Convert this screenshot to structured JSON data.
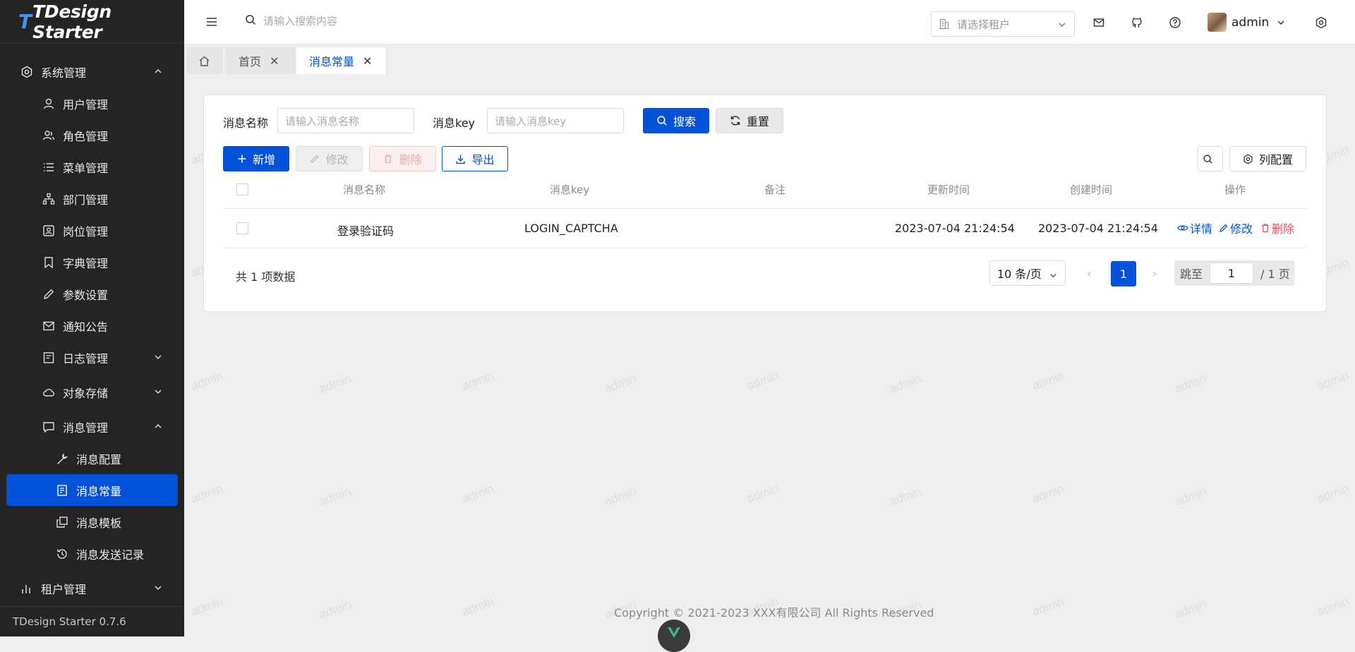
{
  "app": {
    "logo_t": "T",
    "logo_text": "TDesign Starter",
    "version": "TDesign Starter 0.7.6"
  },
  "sidebar": {
    "groups": [
      {
        "label": "系统管理",
        "icon": "system-hexagon-icon",
        "expanded": true
      },
      {
        "label": "用户管理",
        "icon": "user-icon"
      },
      {
        "label": "角色管理",
        "icon": "role-users-icon"
      },
      {
        "label": "菜单管理",
        "icon": "menu-list-icon"
      },
      {
        "label": "部门管理",
        "icon": "org-tree-icon"
      },
      {
        "label": "岗位管理",
        "icon": "id-card-icon"
      },
      {
        "label": "字典管理",
        "icon": "bookmark-icon"
      },
      {
        "label": "参数设置",
        "icon": "pencil-icon"
      },
      {
        "label": "通知公告",
        "icon": "mail-icon"
      },
      {
        "label": "日志管理",
        "icon": "log-icon",
        "expanded": false
      },
      {
        "label": "对象存储",
        "icon": "cloud-icon",
        "expanded": false
      },
      {
        "label": "消息管理",
        "icon": "chat-icon",
        "expanded": true
      },
      {
        "label": "消息配置",
        "icon": "wrench-icon"
      },
      {
        "label": "消息常量",
        "icon": "document-icon",
        "active": true
      },
      {
        "label": "消息模板",
        "icon": "copy-icon"
      },
      {
        "label": "消息发送记录",
        "icon": "history-icon"
      },
      {
        "label": "租户管理",
        "icon": "chart-bar-icon",
        "expanded": false
      }
    ]
  },
  "topbar": {
    "search_placeholder": "请输入搜索内容",
    "tenant_placeholder": "请选择租户",
    "username": "admin"
  },
  "tabs": [
    {
      "label": "首页",
      "active": false
    },
    {
      "label": "消息常量",
      "active": true
    }
  ],
  "filters": {
    "name_label": "消息名称",
    "name_placeholder": "请输入消息名称",
    "key_label": "消息key",
    "key_placeholder": "请输入消息key",
    "search_btn": "搜索",
    "reset_btn": "重置"
  },
  "toolbar": {
    "add": "新增",
    "edit": "修改",
    "delete": "删除",
    "export": "导出",
    "column_config": "列配置"
  },
  "table": {
    "columns": [
      "消息名称",
      "消息key",
      "备注",
      "更新时间",
      "创建时间",
      "操作"
    ],
    "rows": [
      {
        "name": "登录验证码",
        "key": "LOGIN_CAPTCHA",
        "remark": "",
        "updated": "2023-07-04 21:24:54",
        "created": "2023-07-04 21:24:54",
        "actions": {
          "detail": "详情",
          "edit": "修改",
          "delete": "删除"
        }
      }
    ]
  },
  "pagination": {
    "total_text": "共 1 项数据",
    "page_size": "10 条/页",
    "current_page": "1",
    "jump_label": "跳至",
    "jump_value": "1",
    "total_pages": "/ 1 页"
  },
  "footer": {
    "copyright": "Copyright © 2021-2023 XXX有限公司 All Rights Reserved"
  },
  "watermark": "admin",
  "colors": {
    "primary": "#0052d9",
    "sidebar_bg": "#242424",
    "danger": "#e34d59"
  }
}
